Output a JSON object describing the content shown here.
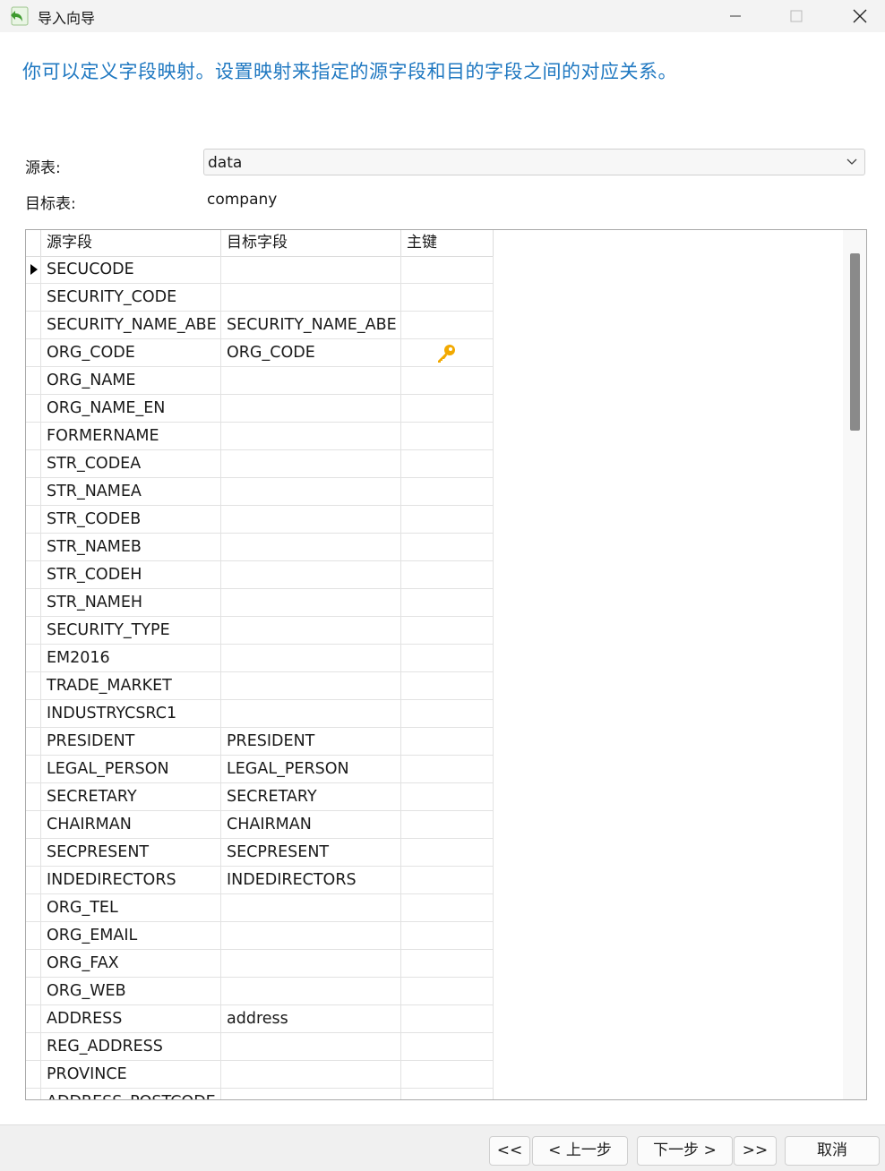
{
  "window": {
    "title": "导入向导",
    "icon": "wizard-back-arrow-icon"
  },
  "instruction": "你可以定义字段映射。设置映射来指定的源字段和目的字段之间的对应关系。",
  "source": {
    "label": "源表:",
    "value": "data"
  },
  "target": {
    "label": "目标表:",
    "value": "company"
  },
  "grid": {
    "columns": [
      "源字段",
      "目标字段",
      "主键"
    ],
    "rows": [
      {
        "src": "SECUCODE",
        "tgt": "",
        "current": true
      },
      {
        "src": "SECURITY_CODE",
        "tgt": ""
      },
      {
        "src": "SECURITY_NAME_ABE",
        "tgt": "SECURITY_NAME_ABE"
      },
      {
        "src": "ORG_CODE",
        "tgt": "ORG_CODE",
        "key": true
      },
      {
        "src": "ORG_NAME",
        "tgt": ""
      },
      {
        "src": "ORG_NAME_EN",
        "tgt": ""
      },
      {
        "src": "FORMERNAME",
        "tgt": ""
      },
      {
        "src": "STR_CODEA",
        "tgt": ""
      },
      {
        "src": "STR_NAMEA",
        "tgt": ""
      },
      {
        "src": "STR_CODEB",
        "tgt": ""
      },
      {
        "src": "STR_NAMEB",
        "tgt": ""
      },
      {
        "src": "STR_CODEH",
        "tgt": ""
      },
      {
        "src": "STR_NAMEH",
        "tgt": ""
      },
      {
        "src": "SECURITY_TYPE",
        "tgt": ""
      },
      {
        "src": "EM2016",
        "tgt": ""
      },
      {
        "src": "TRADE_MARKET",
        "tgt": ""
      },
      {
        "src": "INDUSTRYCSRC1",
        "tgt": ""
      },
      {
        "src": "PRESIDENT",
        "tgt": "PRESIDENT"
      },
      {
        "src": "LEGAL_PERSON",
        "tgt": "LEGAL_PERSON"
      },
      {
        "src": "SECRETARY",
        "tgt": "SECRETARY"
      },
      {
        "src": "CHAIRMAN",
        "tgt": "CHAIRMAN"
      },
      {
        "src": "SECPRESENT",
        "tgt": "SECPRESENT"
      },
      {
        "src": "INDEDIRECTORS",
        "tgt": "INDEDIRECTORS"
      },
      {
        "src": "ORG_TEL",
        "tgt": ""
      },
      {
        "src": "ORG_EMAIL",
        "tgt": ""
      },
      {
        "src": "ORG_FAX",
        "tgt": ""
      },
      {
        "src": "ORG_WEB",
        "tgt": ""
      },
      {
        "src": "ADDRESS",
        "tgt": "address"
      },
      {
        "src": "REG_ADDRESS",
        "tgt": ""
      },
      {
        "src": "PROVINCE",
        "tgt": ""
      },
      {
        "src": "ADDRESS_POSTCODE",
        "tgt": ""
      }
    ]
  },
  "buttons": {
    "first": "<<",
    "prev": "< 上一步",
    "next": "下一步 >",
    "last": ">>",
    "cancel": "取消"
  },
  "colors": {
    "instruction": "#1f78c1",
    "key_icon": "#f2a900"
  }
}
